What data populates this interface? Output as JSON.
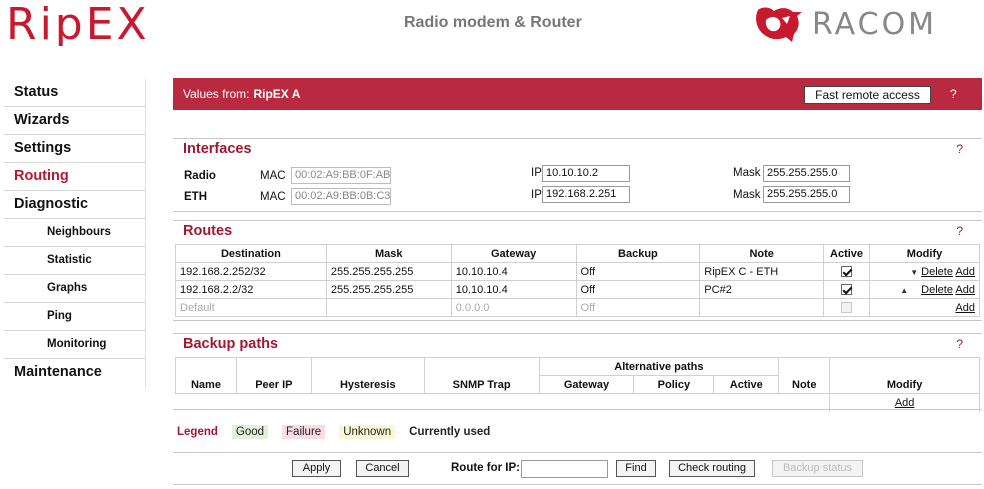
{
  "header": {
    "logo_left": "RipEX",
    "title": "Radio modem & Router",
    "logo_right": "RACOM"
  },
  "sidebar": {
    "items": [
      {
        "label": "Status"
      },
      {
        "label": "Wizards"
      },
      {
        "label": "Settings"
      },
      {
        "label": "Routing",
        "active": true
      },
      {
        "label": "Diagnostic"
      },
      {
        "label": "Neighbours",
        "sub": true
      },
      {
        "label": "Statistic",
        "sub": true
      },
      {
        "label": "Graphs",
        "sub": true
      },
      {
        "label": "Ping",
        "sub": true
      },
      {
        "label": "Monitoring",
        "sub": true
      },
      {
        "label": "Maintenance"
      }
    ]
  },
  "values_bar": {
    "label": "Values from:",
    "value": "RipEX A",
    "fast_remote_access": "Fast remote access",
    "help": "?"
  },
  "interfaces": {
    "title": "Interfaces",
    "help": "?",
    "rows": [
      {
        "name": "Radio",
        "mac_label": "MAC",
        "mac": "00:02:A9:BB:0F:AB",
        "ip_label": "IP",
        "ip": "10.10.10.2",
        "mask_label": "Mask",
        "mask": "255.255.255.0"
      },
      {
        "name": "ETH",
        "mac_label": "MAC",
        "mac": "00:02:A9:BB:0B:C3",
        "ip_label": "IP",
        "ip": "192.168.2.251",
        "mask_label": "Mask",
        "mask": "255.255.255.0"
      }
    ]
  },
  "routes": {
    "title": "Routes",
    "help": "?",
    "columns": [
      "Destination",
      "Mask",
      "Gateway",
      "Backup",
      "Note",
      "Active",
      "Modify"
    ],
    "rows": [
      {
        "destination": "192.168.2.252/32",
        "mask": "255.255.255.255",
        "gateway": "10.10.10.4",
        "backup": "Off",
        "note": "RipEX C - ETH",
        "active": true,
        "delete": "Delete",
        "add": "Add"
      },
      {
        "destination": "192.168.2.2/32",
        "mask": "255.255.255.255",
        "gateway": "10.10.10.4",
        "backup": "Off",
        "note": "PC#2",
        "active": true,
        "delete": "Delete",
        "add": "Add"
      }
    ],
    "default_row": {
      "destination": "Default",
      "gateway": "0.0.0.0",
      "backup": "Off",
      "add": "Add"
    }
  },
  "backup_paths": {
    "title": "Backup paths",
    "help": "?",
    "columns": [
      "Name",
      "Peer IP",
      "Hysteresis",
      "SNMP Trap",
      "Note",
      "Modify"
    ],
    "alt_header": "Alternative paths",
    "alt_columns": [
      "Gateway",
      "Policy",
      "Active"
    ],
    "add": "Add"
  },
  "legend": {
    "title": "Legend",
    "good": "Good",
    "failure": "Failure",
    "unknown": "Unknown",
    "currently_used": "Currently used"
  },
  "bottom": {
    "apply": "Apply",
    "cancel": "Cancel",
    "route_for_ip_label": "Route for IP:",
    "route_for_ip_value": "",
    "find": "Find",
    "check_routing": "Check routing",
    "backup_status": "Backup status"
  },
  "colors": {
    "brand_red": "#c8192e",
    "bar_red": "#b92a41",
    "title_red": "#9e1a30",
    "legend_good": "#e2efd9",
    "legend_failure": "#f9dde0",
    "legend_unknown": "#fbf7d5"
  }
}
